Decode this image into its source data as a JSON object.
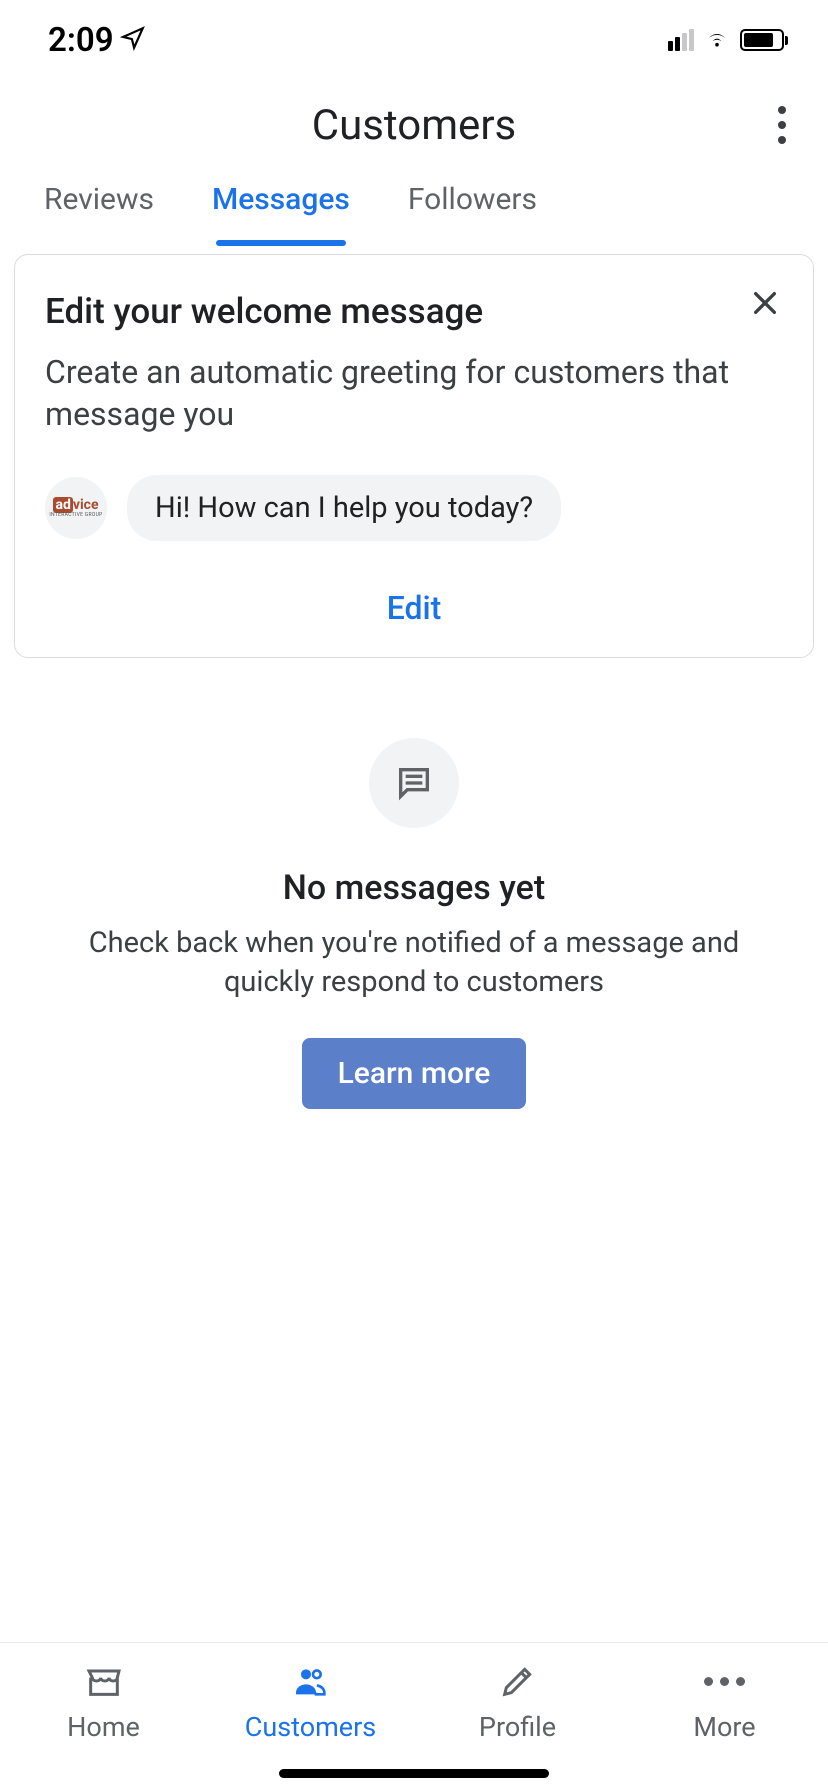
{
  "status": {
    "time": "2:09"
  },
  "header": {
    "title": "Customers"
  },
  "tabs": {
    "reviews": "Reviews",
    "messages": "Messages",
    "followers": "Followers"
  },
  "welcomeCard": {
    "title": "Edit your welcome message",
    "subtitle": "Create an automatic greeting for customers that message you",
    "greeting": "Hi! How can I help you today?",
    "avatarBrand": "advice",
    "avatarBrandSub": "INTERACTIVE GROUP",
    "editLabel": "Edit"
  },
  "emptyState": {
    "title": "No messages yet",
    "description": "Check back when you're notified of a message and quickly respond to customers",
    "cta": "Learn more"
  },
  "bottomNav": {
    "home": "Home",
    "customers": "Customers",
    "profile": "Profile",
    "more": "More"
  }
}
